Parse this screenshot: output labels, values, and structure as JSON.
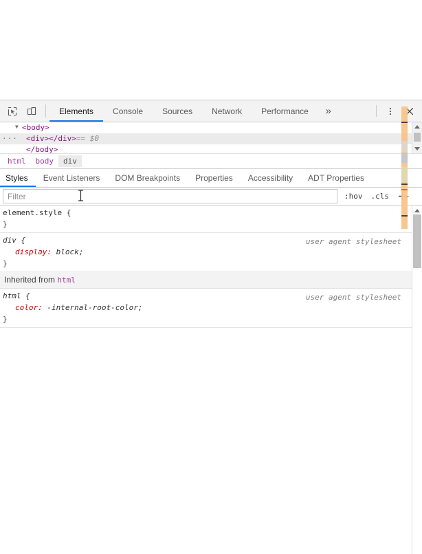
{
  "devtools": {
    "toolbar": {
      "inspect_icon": "inspect-element-icon",
      "device_icon": "device-toolbar-icon",
      "tabs": [
        {
          "label": "Elements",
          "active": true
        },
        {
          "label": "Console",
          "active": false
        },
        {
          "label": "Sources",
          "active": false
        },
        {
          "label": "Network",
          "active": false
        },
        {
          "label": "Performance",
          "active": false
        }
      ],
      "more_tabs_label": "»",
      "menu_icon": "kebab-menu-icon",
      "close_icon": "close-icon"
    },
    "dom_tree": {
      "rows": [
        {
          "twisty": "▼",
          "indent": 1,
          "text": "<body>",
          "selected": false,
          "badge": ""
        },
        {
          "twisty": "",
          "indent": 2,
          "text": "<div></div>  ==  $0",
          "selected": true,
          "badge": "···"
        },
        {
          "twisty": "",
          "indent": 2,
          "text": "</body>",
          "selected": false,
          "badge": ""
        }
      ],
      "open_body_tag": "<body>",
      "div_open": "<div>",
      "div_close": "</div>",
      "div_eq": "== $0",
      "close_body_tag": "</body>"
    },
    "breadcrumb": {
      "items": [
        {
          "label": "html",
          "active": false
        },
        {
          "label": "body",
          "active": false
        },
        {
          "label": "div",
          "active": true
        }
      ]
    },
    "sidebar_tabs": [
      {
        "label": "Styles",
        "active": true
      },
      {
        "label": "Event Listeners",
        "active": false
      },
      {
        "label": "DOM Breakpoints",
        "active": false
      },
      {
        "label": "Properties",
        "active": false
      },
      {
        "label": "Accessibility",
        "active": false
      },
      {
        "label": "ADT Properties",
        "active": false
      }
    ],
    "filter_bar": {
      "placeholder": "Filter",
      "value": "",
      "hov_label": ":hov",
      "cls_label": ".cls",
      "new_rule_icon": "plus-icon"
    },
    "styles": {
      "rules": [
        {
          "selector": "element.style {",
          "selector_italic": false,
          "origin": "",
          "declarations": [],
          "close": "}"
        },
        {
          "selector": "div {",
          "selector_italic": true,
          "origin": "user agent stylesheet",
          "declarations": [
            {
              "name": "display:",
              "value": "block;"
            }
          ],
          "close": "}"
        }
      ],
      "inherited_label": "Inherited from",
      "inherited_from": "html",
      "inherited_rules": [
        {
          "selector": "html {",
          "selector_italic": true,
          "origin": "user agent stylesheet",
          "declarations": [
            {
              "name": "color:",
              "value": "-internal-root-color;"
            }
          ],
          "close": "}"
        }
      ]
    }
  },
  "colors": {
    "accent": "#1a73e8",
    "tag": "#881280",
    "crumb": "#a33e9c",
    "prop_name": "#c80000",
    "origin": "#808080",
    "toolbar_bg": "#f3f3f3",
    "selected_row": "#ebebeb",
    "amber": "#f7c58a"
  }
}
